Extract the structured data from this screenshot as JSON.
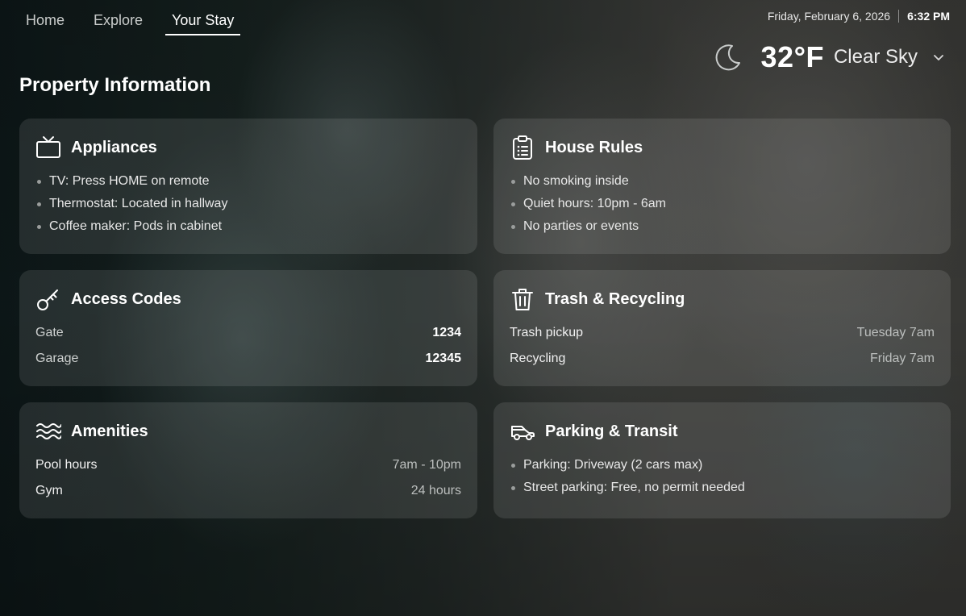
{
  "nav": {
    "tabs": [
      "Home",
      "Explore",
      "Your Stay"
    ],
    "active": "Your Stay"
  },
  "header": {
    "date": "Friday, February 6, 2026",
    "time": "6:32 PM"
  },
  "weather": {
    "icon": "moon-icon",
    "temperature": "32°F",
    "condition": "Clear Sky"
  },
  "page": {
    "title": "Property Information"
  },
  "cards": {
    "appliances": {
      "title": "Appliances",
      "icon": "tv-icon",
      "items": [
        "TV: Press HOME on remote",
        "Thermostat: Located in hallway",
        "Coffee maker: Pods in cabinet"
      ]
    },
    "house_rules": {
      "title": "House Rules",
      "icon": "clipboard-icon",
      "items": [
        "No smoking inside",
        "Quiet hours: 10pm - 6am",
        "No parties or events"
      ]
    },
    "access_codes": {
      "title": "Access Codes",
      "icon": "key-icon",
      "rows": [
        {
          "label": "Gate",
          "value": "1234"
        },
        {
          "label": "Garage",
          "value": "12345"
        }
      ]
    },
    "trash": {
      "title": "Trash & Recycling",
      "icon": "trash-icon",
      "rows": [
        {
          "label": "Trash pickup",
          "value": "Tuesday 7am"
        },
        {
          "label": "Recycling",
          "value": "Friday 7am"
        }
      ]
    },
    "amenities": {
      "title": "Amenities",
      "icon": "waves-icon",
      "rows": [
        {
          "label": "Pool hours",
          "value": "7am - 10pm"
        },
        {
          "label": "Gym",
          "value": "24 hours"
        }
      ]
    },
    "parking": {
      "title": "Parking & Transit",
      "icon": "car-icon",
      "items": [
        "Parking: Driveway (2 cars max)",
        "Street parking: Free, no permit needed"
      ]
    }
  }
}
